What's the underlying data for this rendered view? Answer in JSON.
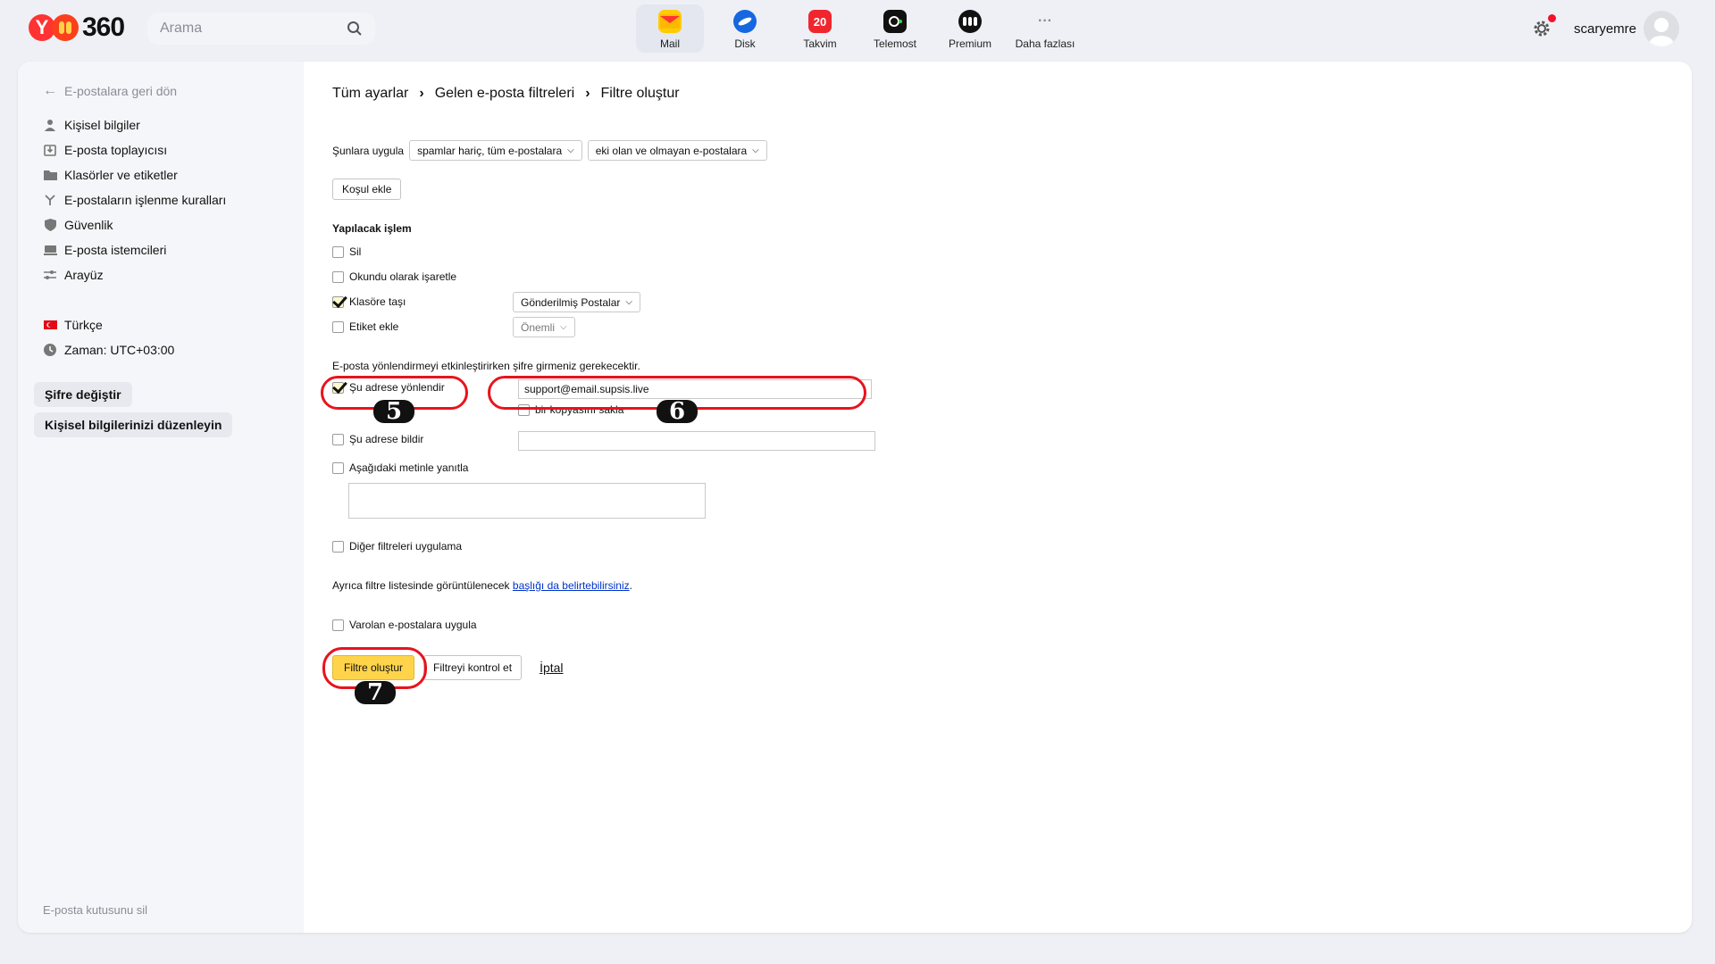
{
  "header": {
    "logo_text": "360",
    "logo_letter": "Y",
    "search_placeholder": "Arama",
    "apps": [
      {
        "label": "Mail",
        "icon": "mail-icon",
        "active": true
      },
      {
        "label": "Disk",
        "icon": "disk-icon"
      },
      {
        "label": "Takvim",
        "icon": "calendar-icon",
        "badge": "20"
      },
      {
        "label": "Telemost",
        "icon": "telemost-icon"
      },
      {
        "label": "Premium",
        "icon": "premium-icon"
      },
      {
        "label": "Daha fazlası",
        "icon": "more-icon"
      }
    ],
    "username": "scaryemre"
  },
  "sidebar": {
    "back": "E-postalara geri dön",
    "items": [
      {
        "label": "Kişisel bilgiler",
        "icon": "person-icon"
      },
      {
        "label": "E-posta toplayıcısı",
        "icon": "collector-icon"
      },
      {
        "label": "Klasörler ve etiketler",
        "icon": "folder-icon"
      },
      {
        "label": "E-postaların işlenme kuralları",
        "icon": "rules-icon"
      },
      {
        "label": "Güvenlik",
        "icon": "shield-icon"
      },
      {
        "label": "E-posta istemcileri",
        "icon": "clients-icon"
      },
      {
        "label": "Arayüz",
        "icon": "sliders-icon"
      }
    ],
    "language": "Türkçe",
    "timezone": "Zaman: UTC+03:00",
    "change_password": "Şifre değiştir",
    "edit_personal": "Kişisel bilgilerinizi düzenleyin",
    "delete_mailbox": "E-posta kutusunu sil"
  },
  "breadcrumb": [
    "Tüm ayarlar",
    "Gelen e-posta filtreleri",
    "Filtre oluştur"
  ],
  "filter": {
    "apply_to_label": "Şunlara uygula",
    "apply_scope": "spamlar hariç, tüm e-postalara",
    "apply_attach": "eki olan ve olmayan e-postalara",
    "add_condition": "Koşul ekle",
    "action_heading": "Yapılacak işlem",
    "delete": "Sil",
    "mark_read": "Okundu olarak işaretle",
    "move_folder": "Klasöre taşı",
    "folder_value": "Gönderilmiş Postalar",
    "add_label": "Etiket ekle",
    "label_value": "Önemli",
    "password_note": "E-posta yönlendirmeyi etkinleştirirken şifre girmeniz gerekecektir.",
    "forward_to": "Şu adrese yönlendir",
    "forward_value": "support@email.supsis.live",
    "keep_copy": "bir kopyasını sakla",
    "notify_to": "Şu adrese bildir",
    "reply_with": "Aşağıdaki metinle yanıtla",
    "dont_apply_others": "Diğer filtreleri uygulama",
    "title_note_prefix": "Ayrıca filtre listesinde görüntülenecek ",
    "title_note_link": "başlığı da belirtebilirsiniz",
    "title_note_suffix": ".",
    "apply_existing": "Varolan e-postalara uygula",
    "create_button": "Filtre oluştur",
    "check_button": "Filtreyi kontrol et",
    "cancel": "İptal"
  },
  "annotations": [
    "5",
    "6",
    "7"
  ],
  "colors": {
    "accent": "#ffd44a",
    "annotation": "#e8131c",
    "link": "#0033cc"
  }
}
